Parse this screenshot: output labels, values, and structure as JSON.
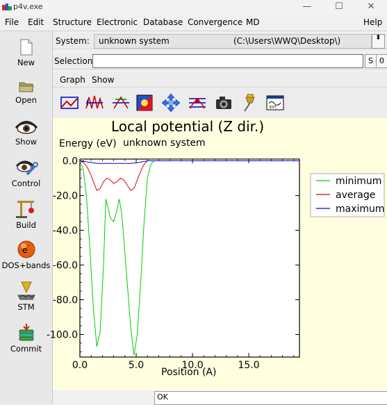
{
  "window": {
    "title": "p4v.exe",
    "minimize": "—",
    "maximize": "☐",
    "close": "✕"
  },
  "menu": [
    "File",
    "Edit",
    "Structure",
    "Electronic",
    "Database",
    "Convergence",
    "MD",
    "Help"
  ],
  "sidebar": [
    {
      "label": "New",
      "icon": "new-document-icon"
    },
    {
      "label": "Open",
      "icon": "folder-icon"
    },
    {
      "label": "Show",
      "icon": "eye-icon"
    },
    {
      "label": "Control",
      "icon": "eye-wrench-icon"
    },
    {
      "label": "Build",
      "icon": "crane-icon"
    },
    {
      "label": "DOS+bands",
      "icon": "electron-icon"
    },
    {
      "label": "STM",
      "icon": "stm-tip-icon"
    },
    {
      "label": "Commit",
      "icon": "server-stack-icon"
    }
  ],
  "system_row": {
    "label": "System:",
    "name": "unknown system",
    "path": "(C:\\Users\\WWQ\\Desktop\\)",
    "spinner": "⬍"
  },
  "selection_row": {
    "label": "Selection:",
    "value": "",
    "s_button": "S",
    "zero_button": "0"
  },
  "graph_menu": [
    "Graph",
    "Show"
  ],
  "toolbar_icons": [
    "line-plot-icon",
    "peaks-plot-icon",
    "axis-plot-icon",
    "color-palette-icon",
    "move-arrows-icon",
    "curve-markers-icon",
    "camera-icon",
    "pushpin-icon",
    "ext-window-icon"
  ],
  "chart_data": {
    "type": "line",
    "title": "Local potential (Z dir.)",
    "subtitle": "unknown system",
    "xlabel": "Position (A)",
    "ylabel": "Energy (eV)",
    "xlim": [
      0,
      19.5
    ],
    "ylim": [
      -113,
      1
    ],
    "x_ticks": [
      "0.0",
      "5.0",
      "10.0",
      "15.0"
    ],
    "y_ticks": [
      "0.0",
      "-20.0",
      "-40.0",
      "-60.0",
      "-80.0",
      "-100.0"
    ],
    "x_tick_values": [
      0,
      5,
      10,
      15
    ],
    "y_tick_values": [
      0,
      -20,
      -40,
      -60,
      -80,
      -100
    ],
    "legend_position": "right",
    "series": [
      {
        "name": "minimum",
        "color": "#00cc00",
        "x": [
          0,
          0.3,
          0.6,
          0.9,
          1.2,
          1.5,
          1.8,
          2.1,
          2.3,
          2.5,
          2.7,
          3.0,
          3.3,
          3.5,
          3.7,
          3.9,
          4.2,
          4.5,
          4.8,
          5.1,
          5.4,
          5.7,
          6.0,
          6.3,
          6.6,
          7.0,
          8.0,
          10.0,
          12.0,
          15.0,
          19.5
        ],
        "y": [
          0,
          -5,
          -22,
          -52,
          -85,
          -107,
          -98,
          -60,
          -22,
          -27,
          -33,
          -35,
          -28,
          -22,
          -30,
          -45,
          -70,
          -95,
          -112,
          -100,
          -70,
          -35,
          -10,
          -2,
          0,
          0,
          0,
          0,
          0,
          0,
          0
        ]
      },
      {
        "name": "average",
        "color": "#dd0000",
        "x": [
          0,
          0.3,
          0.6,
          0.9,
          1.2,
          1.5,
          1.8,
          2.1,
          2.4,
          2.7,
          3.0,
          3.3,
          3.6,
          3.9,
          4.2,
          4.5,
          4.8,
          5.1,
          5.4,
          5.7,
          6.0,
          6.5,
          7.0,
          10.0,
          15.0,
          19.5
        ],
        "y": [
          0,
          -1,
          -3,
          -7,
          -12,
          -17,
          -16,
          -12,
          -10,
          -11,
          -13,
          -12,
          -10,
          -11,
          -14,
          -17,
          -16,
          -11,
          -6,
          -2,
          0,
          0,
          0,
          0,
          0,
          0
        ]
      },
      {
        "name": "maximum",
        "color": "#0000dd",
        "x": [
          0,
          0.5,
          1.0,
          1.5,
          2.0,
          2.5,
          3.0,
          3.5,
          4.0,
          4.5,
          5.0,
          5.5,
          6.0,
          7.0,
          10.0,
          15.0,
          19.5
        ],
        "y": [
          0,
          -0.5,
          -1,
          -1.5,
          -1.5,
          -1.5,
          -1.5,
          -1.5,
          -1.5,
          -1.5,
          -1.2,
          -0.6,
          0,
          0,
          0,
          0,
          0
        ]
      }
    ]
  },
  "status": {
    "text": "OK"
  }
}
